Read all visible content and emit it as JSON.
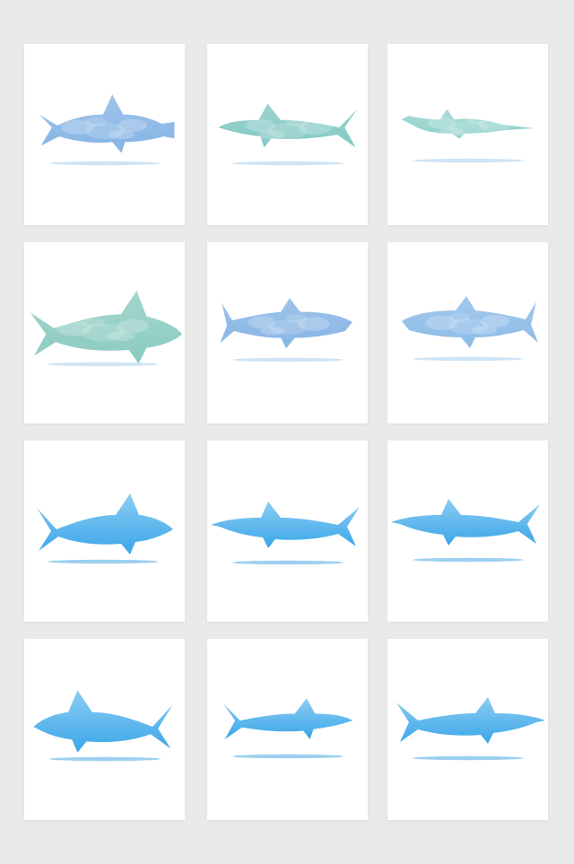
{
  "background_color": "#e9e9e9",
  "card_color": "#ffffff",
  "cards": [
    {
      "icon": "hammerhead-shark-icon",
      "style": "watercolor",
      "tint": "#7fb0e3"
    },
    {
      "icon": "shark-icon",
      "style": "watercolor",
      "tint": "#7cc5c0"
    },
    {
      "icon": "nurse-shark-icon",
      "style": "watercolor",
      "tint": "#8bcfc8"
    },
    {
      "icon": "shark-icon",
      "style": "watercolor",
      "tint": "#85c8bd"
    },
    {
      "icon": "whale-shark-icon",
      "style": "watercolor",
      "tint": "#7fb0e3"
    },
    {
      "icon": "whale-shark-icon",
      "style": "watercolor",
      "tint": "#86b7e6"
    },
    {
      "icon": "great-white-shark-icon",
      "style": "gradient",
      "tint": "#3aa6e8"
    },
    {
      "icon": "shark-icon",
      "style": "gradient",
      "tint": "#3aa6e8"
    },
    {
      "icon": "shark-icon",
      "style": "gradient",
      "tint": "#3aa6e8"
    },
    {
      "icon": "shark-icon",
      "style": "gradient",
      "tint": "#3aa6e8"
    },
    {
      "icon": "shark-icon",
      "style": "gradient",
      "tint": "#3aa6e8"
    },
    {
      "icon": "shark-icon",
      "style": "gradient",
      "tint": "#3aa6e8"
    }
  ]
}
